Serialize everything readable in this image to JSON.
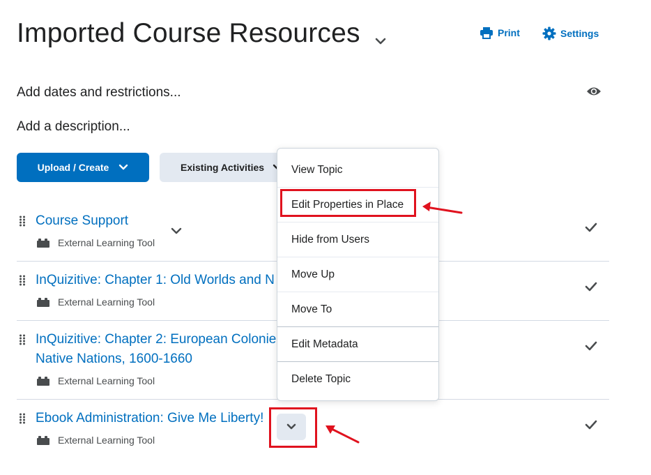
{
  "header": {
    "title": "Imported Course Resources",
    "print_label": "Print",
    "settings_label": "Settings"
  },
  "meta": {
    "dates_label": "Add dates and restrictions...",
    "description_label": "Add a description..."
  },
  "toolbar": {
    "upload_create_label": "Upload / Create",
    "existing_activities_label": "Existing Activities"
  },
  "topics": [
    {
      "title": "Course Support",
      "type": "External Learning Tool"
    },
    {
      "title": "InQuizitive: Chapter 1: Old Worlds and N",
      "type": "External Learning Tool"
    },
    {
      "title_line1": "InQuizitive: Chapter 2: European Colonie",
      "title_line2": "Native Nations, 1600-1660",
      "type": "External Learning Tool"
    },
    {
      "title": "Ebook Administration: Give Me Liberty!",
      "type": "External Learning Tool"
    }
  ],
  "context_menu": {
    "items": [
      "View Topic",
      "Edit Properties in Place",
      "Hide from Users",
      "Move Up",
      "Move To",
      "Edit Metadata",
      "Delete Topic"
    ]
  },
  "colors": {
    "link_blue": "#006fbf",
    "annotation_red": "#e0121e",
    "secondary_button": "#e3e9f1"
  },
  "icons": {
    "print": "printer-icon",
    "settings": "gear-icon",
    "visibility": "eye-icon",
    "drag": "drag-handle-icon",
    "tool": "puzzle-piece-icon",
    "completed": "checkmark-icon"
  }
}
